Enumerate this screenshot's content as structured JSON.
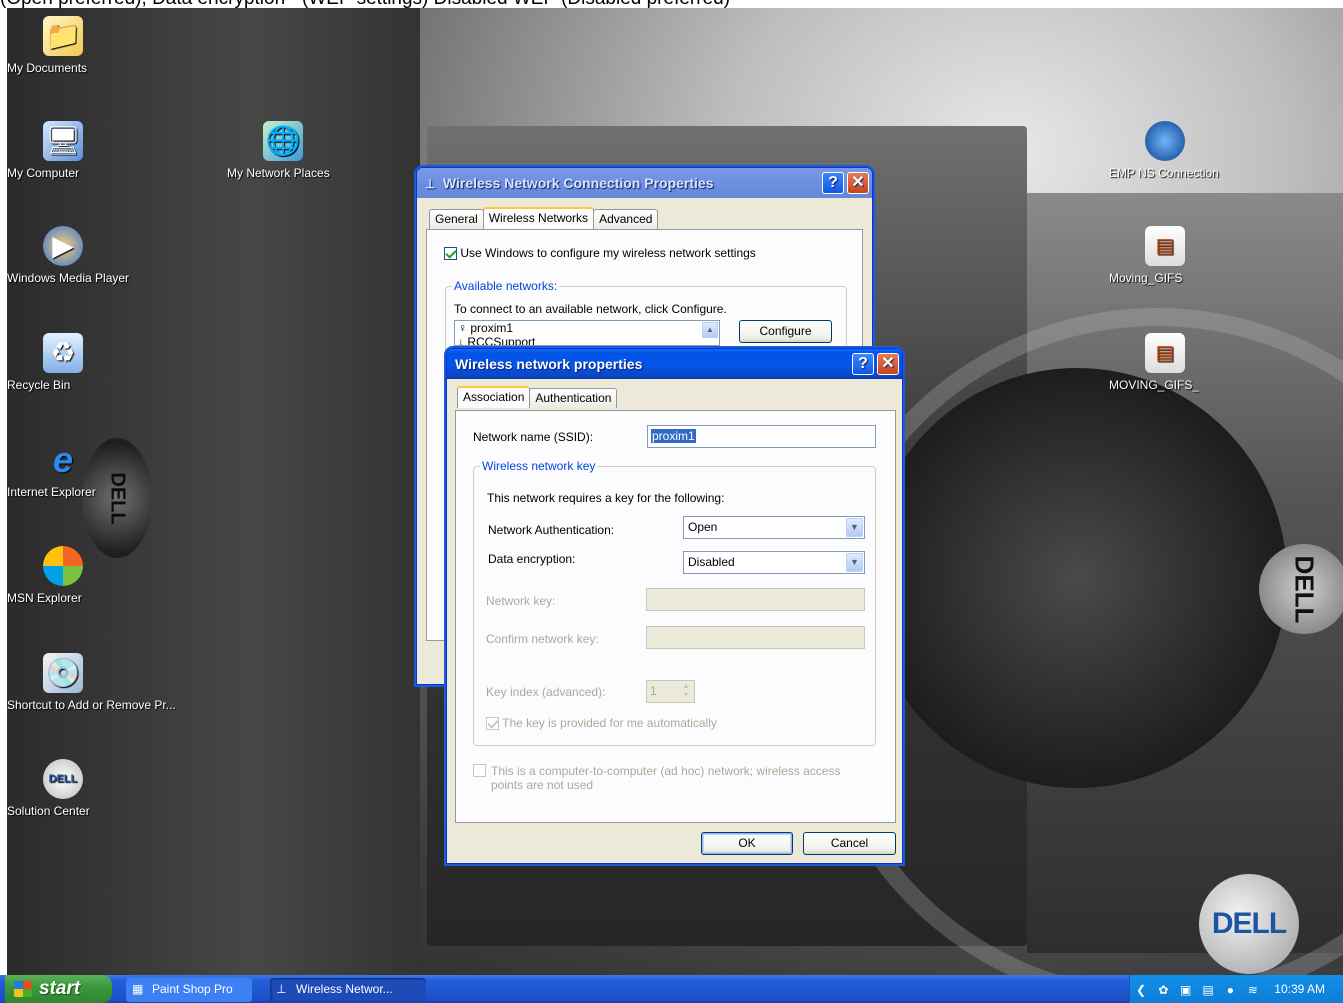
{
  "caption": "(Open preferred), Data encryption - (WEP settings) Disabled WEP (Disabled preferred)",
  "desktop_icons": {
    "my_documents": "My Documents",
    "my_computer": "My Computer",
    "my_network_places": "My Network Places",
    "windows_media_player": "Windows Media Player",
    "recycle_bin": "Recycle Bin",
    "internet_explorer": "Internet Explorer",
    "msn_explorer": "MSN Explorer",
    "add_remove": "Shortcut to Add or Remove Pr...",
    "solution_center": "Solution Center",
    "emp_ns": "EMP NS Connection",
    "moving_gifs": "Moving_GIFS",
    "moving_gifs_2": "MOVING_GIFS_"
  },
  "wallpaper": {
    "badge_text": "DELL"
  },
  "outer_dialog": {
    "title": "Wireless Network Connection Properties",
    "tabs": [
      "General",
      "Wireless Networks",
      "Advanced"
    ],
    "active_tab": "Wireless Networks",
    "use_windows_label": "Use Windows to configure my wireless network settings",
    "use_windows_checked": true,
    "available_networks_title": "Available networks:",
    "connect_hint": "To connect to an available network, click Configure.",
    "networks": [
      "proxim1",
      "RCCSupport"
    ],
    "configure_label": "Configure"
  },
  "inner_dialog": {
    "title": "Wireless network properties",
    "tabs": [
      "Association",
      "Authentication"
    ],
    "active_tab": "Association",
    "ssid_label": "Network name (SSID):",
    "ssid_value": "proxim1",
    "key_group_title": "Wireless network key",
    "key_intro": "This network requires a key for the following:",
    "auth_label": "Network Authentication:",
    "auth_value": "Open",
    "encryption_label": "Data encryption:",
    "encryption_value": "Disabled",
    "network_key_label": "Network key:",
    "confirm_key_label": "Confirm network key:",
    "key_index_label": "Key index (advanced):",
    "key_index_value": "1",
    "auto_key_label": "The key is provided for me automatically",
    "auto_key_checked": true,
    "adhoc_label": "This is a computer-to-computer (ad hoc) network; wireless access points are not used",
    "adhoc_checked": false,
    "ok_label": "OK",
    "cancel_label": "Cancel"
  },
  "taskbar": {
    "start_label": "start",
    "tasks": [
      "Paint Shop Pro",
      "Wireless Networ..."
    ],
    "clock": "10:39 AM"
  },
  "colors": {
    "title_active": "#0054e3",
    "dialog_face": "#ece9d8",
    "group_title": "#0046d5",
    "taskbar": "#245edb",
    "start_green": "#3c9a3c"
  }
}
